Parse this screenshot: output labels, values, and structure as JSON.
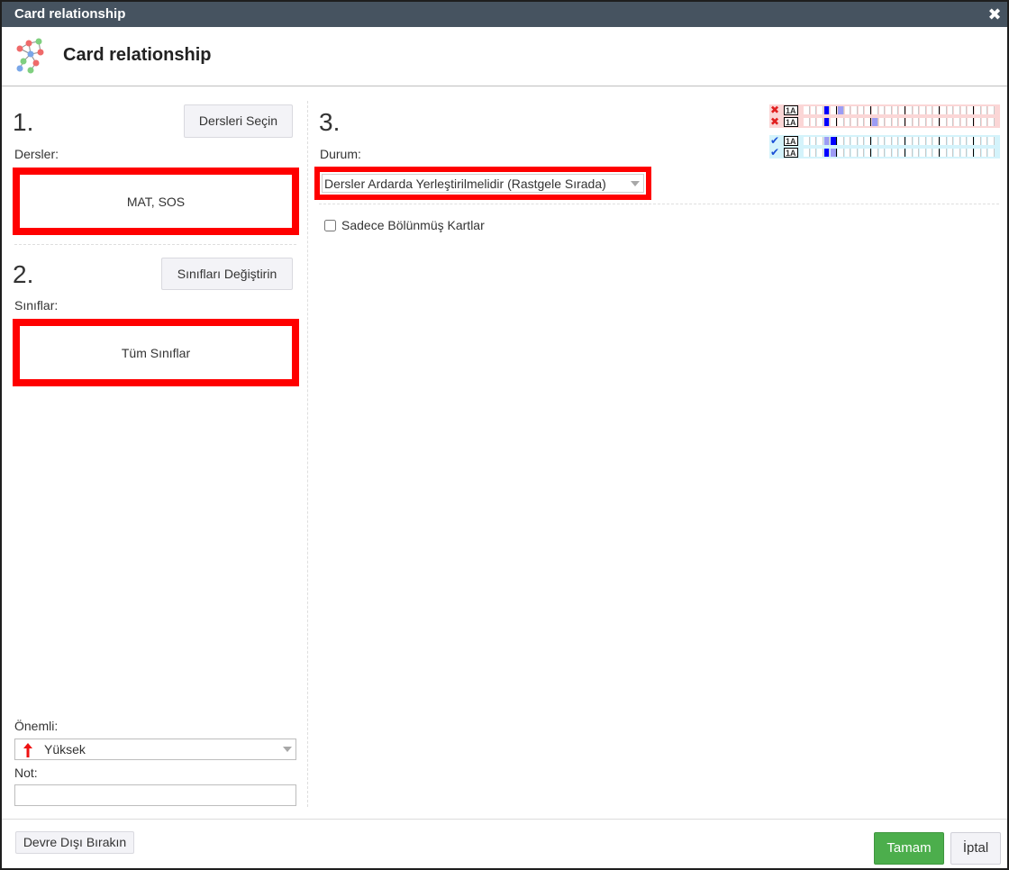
{
  "window": {
    "title": "Card relationship",
    "close_glyph": "✖"
  },
  "header": {
    "title": "Card relationship",
    "icon": "network-graph-icon"
  },
  "left": {
    "step1": "1.",
    "select_subjects_button": "Dersleri Seçin",
    "subjects_label": "Dersler:",
    "subjects_value": "MAT, SOS",
    "step2": "2.",
    "change_classes_button": "Sınıfları Değiştirin",
    "classes_label": "Sınıflar:",
    "classes_value": "Tüm Sınıflar",
    "importance_label": "Önemli:",
    "importance_value": "Yüksek",
    "importance_icon": "arrow-up-icon",
    "note_label": "Not:",
    "note_value": ""
  },
  "right": {
    "step3": "3.",
    "status_label": "Durum:",
    "status_value": "Dersler Ardarda Yerleştirilmelidir (Rastgele Sırada)",
    "split_cards_label": "Sadece Bölünmüş Kartlar",
    "split_cards_checked": false,
    "legend": {
      "rows": [
        {
          "mark": "✖",
          "label": "1A",
          "status": "invalid",
          "filled": [
            3
          ],
          "light": [
            5
          ]
        },
        {
          "mark": "✖",
          "label": "1A",
          "status": "invalid",
          "filled": [
            3
          ],
          "light": [
            10
          ]
        },
        {
          "mark": "✔",
          "label": "1A",
          "status": "valid",
          "filled": [
            4
          ],
          "light": [
            3
          ]
        },
        {
          "mark": "✔",
          "label": "1A",
          "status": "valid",
          "filled": [
            3
          ],
          "light": [
            4
          ]
        }
      ]
    }
  },
  "footer": {
    "disable_button": "Devre Dışı Bırakın",
    "ok_button": "Tamam",
    "cancel_button": "İptal"
  },
  "colors": {
    "titlebar": "#465360",
    "highlight": "#ff0000",
    "ok": "#4cae4c",
    "invalid_mark": "#e02020",
    "valid_mark": "#1a4fd6",
    "legend_filled": "#0000ff",
    "legend_light": "#9c9cf5"
  }
}
